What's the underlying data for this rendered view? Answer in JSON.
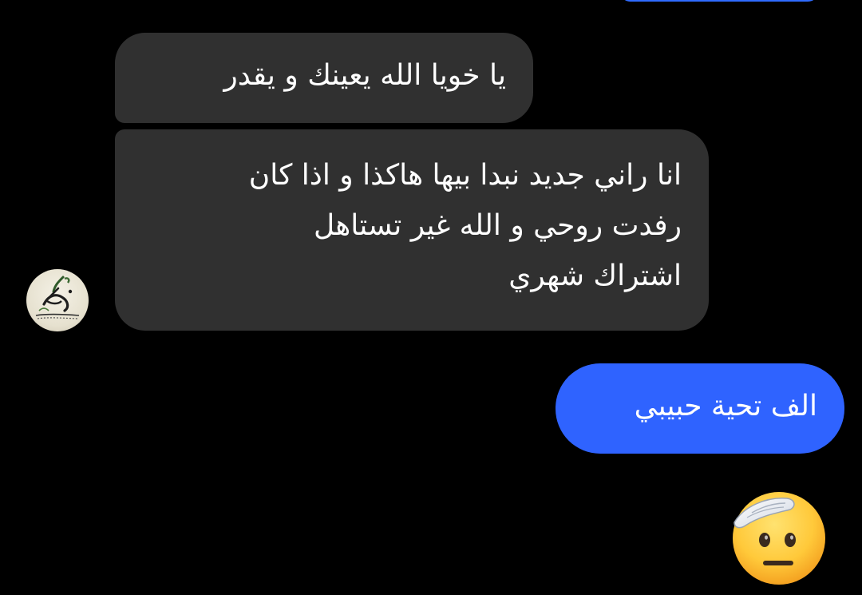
{
  "conversation": {
    "messages": [
      {
        "direction": "incoming",
        "text": "يا خويا الله يعينك و يقدر"
      },
      {
        "direction": "incoming",
        "lines": [
          "انا راني جديد نبدا بيها هاكذا و اذا كان",
          "رفدت روحي و الله غير تستاهل",
          "اشتراك شهري"
        ]
      },
      {
        "direction": "outgoing",
        "text": "الف تحية حبيبي"
      }
    ],
    "reaction_emoji": "saluting-face",
    "avatar_icon": "calligraphy-avatar-icon"
  },
  "colors": {
    "background": "#000000",
    "incoming_bubble": "#303030",
    "outgoing_bubble": "#2f63ff",
    "text": "#ffffff"
  }
}
